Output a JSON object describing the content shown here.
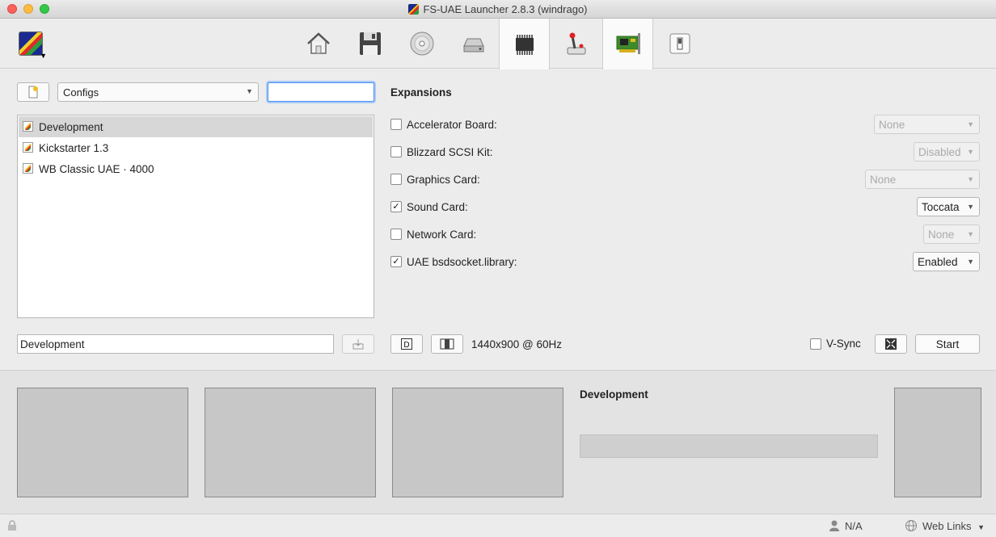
{
  "window": {
    "title": "FS-UAE Launcher 2.8.3 (windrago)"
  },
  "toolbar": {
    "tabs": [
      {
        "name": "home",
        "icon": "home-icon"
      },
      {
        "name": "floppies",
        "icon": "floppy-icon"
      },
      {
        "name": "cdroms",
        "icon": "cdrom-icon"
      },
      {
        "name": "hard-drives",
        "icon": "hard-drive-icon"
      },
      {
        "name": "hardware",
        "icon": "chip-icon"
      },
      {
        "name": "input",
        "icon": "joystick-icon"
      },
      {
        "name": "expansions",
        "icon": "expansion-card-icon",
        "active": true
      },
      {
        "name": "additional",
        "icon": "switch-icon"
      }
    ]
  },
  "configs": {
    "select_value": "Configs",
    "search_value": "",
    "items": [
      {
        "label": "Development",
        "selected": true
      },
      {
        "label": "Kickstarter 1.3",
        "selected": false
      },
      {
        "label": "WB Classic UAE · 4000",
        "selected": false
      }
    ],
    "name_value": "Development"
  },
  "expansions": {
    "title": "Expansions",
    "rows": [
      {
        "label": "Accelerator Board:",
        "checked": false,
        "value": "None",
        "enabled": false
      },
      {
        "label": "Blizzard SCSI Kit:",
        "checked": false,
        "value": "Disabled",
        "enabled": false
      },
      {
        "label": "Graphics Card:",
        "checked": false,
        "value": "None",
        "enabled": false
      },
      {
        "label": "Sound Card:",
        "checked": true,
        "value": "Toccata",
        "enabled": true
      },
      {
        "label": "Network Card:",
        "checked": false,
        "value": "None",
        "enabled": false
      },
      {
        "label": "UAE bsdsocket.library:",
        "checked": true,
        "value": "Enabled",
        "enabled": true
      }
    ]
  },
  "bottom_controls": {
    "resolution": "1440x900 @ 60Hz",
    "vsync_label": "V-Sync",
    "start_label": "Start"
  },
  "preview": {
    "title": "Development"
  },
  "status": {
    "na": "N/A",
    "web_links": "Web Links"
  },
  "colors": {
    "accent": "#4b8ff0",
    "bg": "#ececec",
    "card_green": "#3d8a2a"
  }
}
